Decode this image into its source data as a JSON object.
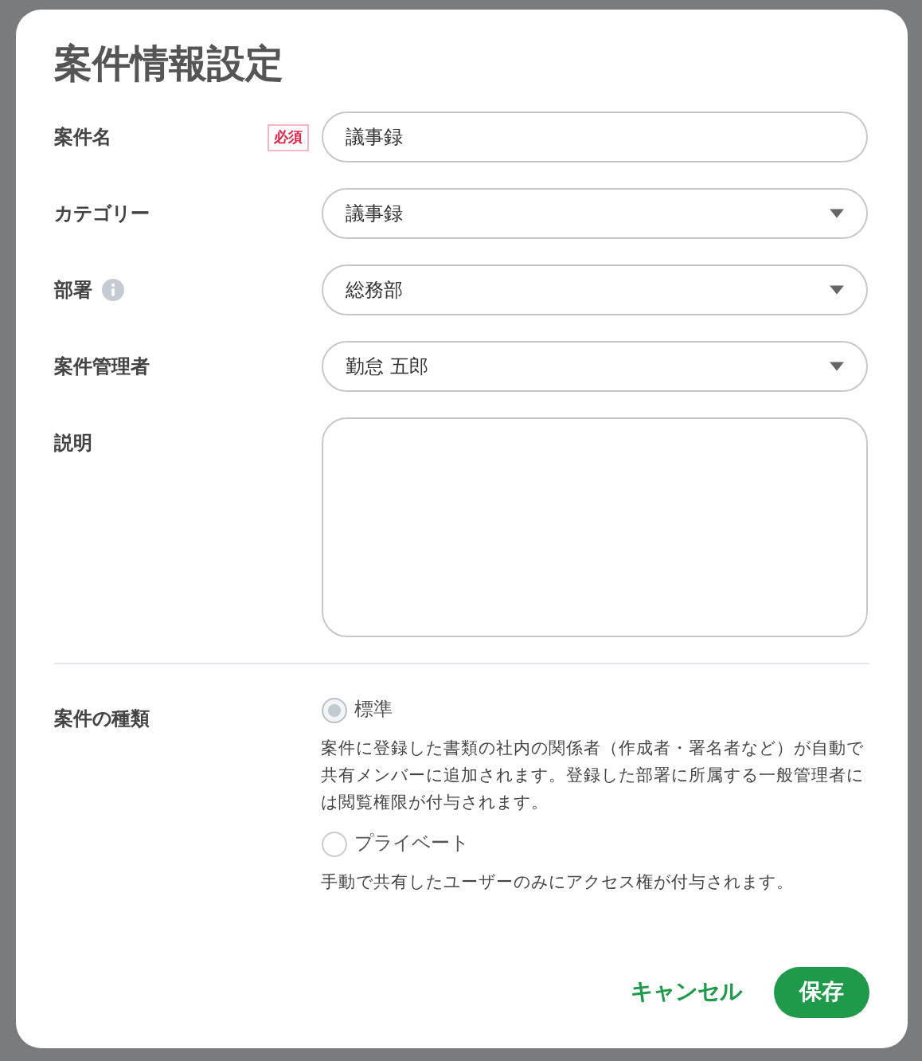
{
  "dialog": {
    "title": "案件情報設定",
    "fields": [
      {
        "kind": "text",
        "label": "案件名",
        "required_badge": "必須",
        "value": "議事録"
      },
      {
        "kind": "select",
        "label": "カテゴリー",
        "value": "議事録"
      },
      {
        "kind": "select",
        "label": "部署",
        "info": true,
        "value": "総務部"
      },
      {
        "kind": "select",
        "label": "案件管理者",
        "value": "勤怠 五郎"
      },
      {
        "kind": "textarea",
        "label": "説明"
      }
    ],
    "type_section": {
      "label": "案件の種類",
      "options": [
        {
          "label": "標準",
          "selected": true,
          "description": "案件に登録した書類の社内の関係者（作成者・署名者など）が自動で共有メンバーに追加されます。登録した部署に所属する一般管理者には閲覧権限が付与されます。"
        },
        {
          "label": "プライベート",
          "selected": false,
          "description": "手動で共有したユーザーのみにアクセス権が付与されます。"
        }
      ]
    },
    "buttons": [
      {
        "kind": "text",
        "label": "キャンセル"
      },
      {
        "kind": "primary",
        "label": "保存"
      }
    ]
  }
}
